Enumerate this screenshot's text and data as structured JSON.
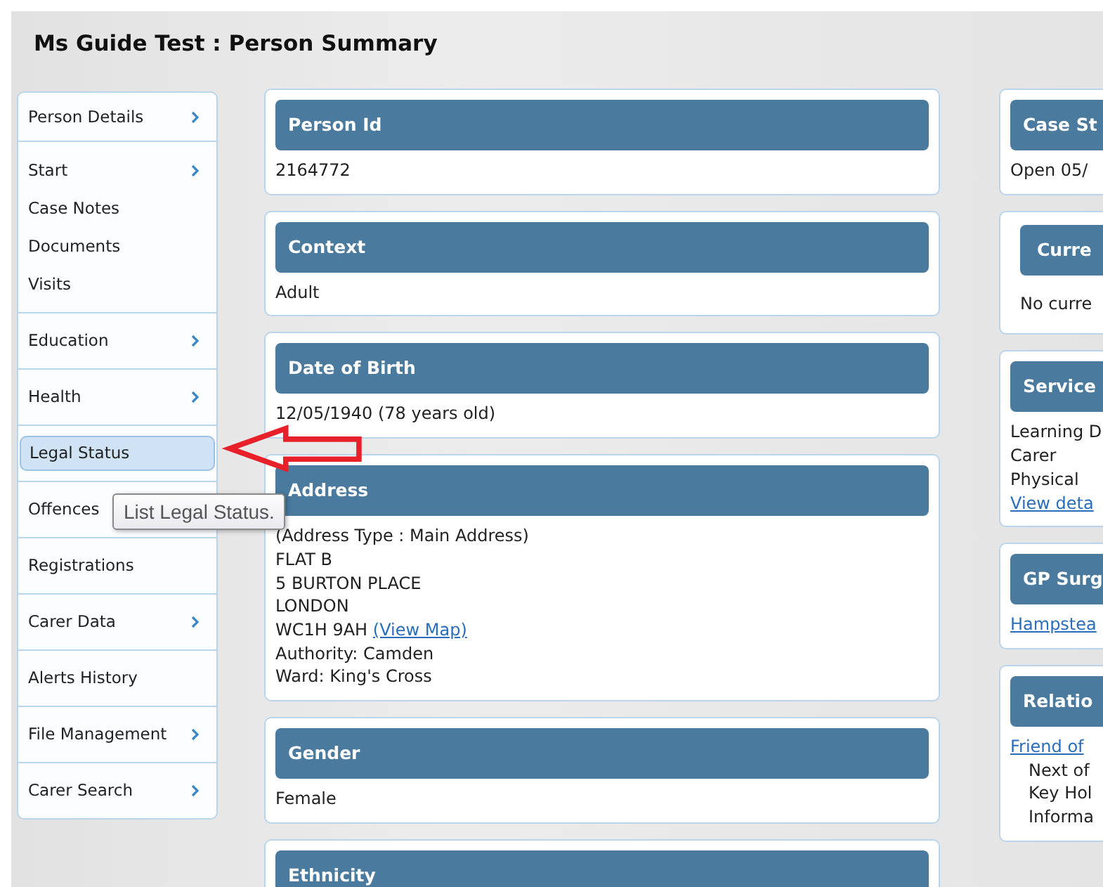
{
  "page": {
    "title": "Ms Guide Test : Person Summary"
  },
  "sidebar": {
    "groups": [
      {
        "items": [
          {
            "label": "Person Details",
            "has_submenu": true,
            "selected": false
          }
        ]
      },
      {
        "items": [
          {
            "label": "Start",
            "has_submenu": true,
            "selected": false
          },
          {
            "label": "Case Notes",
            "has_submenu": false,
            "selected": false
          },
          {
            "label": "Documents",
            "has_submenu": false,
            "selected": false
          },
          {
            "label": "Visits",
            "has_submenu": false,
            "selected": false
          }
        ]
      },
      {
        "items": [
          {
            "label": "Education",
            "has_submenu": true,
            "selected": false
          }
        ]
      },
      {
        "items": [
          {
            "label": "Health",
            "has_submenu": true,
            "selected": false
          }
        ]
      },
      {
        "items": [
          {
            "label": "Legal Status",
            "has_submenu": false,
            "selected": true
          }
        ]
      },
      {
        "items": [
          {
            "label": "Offences",
            "selected": false
          }
        ]
      },
      {
        "items": [
          {
            "label": "Registrations",
            "has_submenu": false,
            "selected": false
          }
        ]
      },
      {
        "items": [
          {
            "label": "Carer Data",
            "has_submenu": true,
            "selected": false
          }
        ]
      },
      {
        "items": [
          {
            "label": "Alerts History",
            "has_submenu": false,
            "selected": false
          }
        ]
      },
      {
        "items": [
          {
            "label": "File Management",
            "has_submenu": true,
            "selected": false
          }
        ]
      },
      {
        "items": [
          {
            "label": "Carer Search",
            "has_submenu": true,
            "selected": false
          }
        ]
      }
    ]
  },
  "tooltip": {
    "text": "List Legal Status."
  },
  "main_cards": [
    {
      "title": "Person Id",
      "lines": [
        {
          "kind": "text",
          "text": "2164772"
        }
      ]
    },
    {
      "title": "Context",
      "lines": [
        {
          "kind": "text",
          "text": "Adult"
        }
      ]
    },
    {
      "title": "Date of Birth",
      "lines": [
        {
          "kind": "text",
          "text": "12/05/1940 (78 years old)"
        }
      ]
    },
    {
      "title": "Address",
      "lines": [
        {
          "kind": "text",
          "text": "(Address Type : Main Address)"
        },
        {
          "kind": "text",
          "text": "FLAT B"
        },
        {
          "kind": "text",
          "text": "5 BURTON PLACE"
        },
        {
          "kind": "text",
          "text": "LONDON"
        },
        {
          "kind": "text",
          "text": "WC1H 9AH",
          "link": "(View Map)"
        },
        {
          "kind": "text",
          "text": "Authority: Camden"
        },
        {
          "kind": "text",
          "text": "Ward: King's Cross"
        }
      ]
    },
    {
      "title": "Gender",
      "lines": [
        {
          "kind": "text",
          "text": "Female"
        }
      ]
    },
    {
      "title": "Ethnicity"
    }
  ],
  "side_cards": [
    {
      "title": "Case St",
      "inset": false,
      "lines": [
        {
          "kind": "text",
          "text": "Open 05/"
        }
      ]
    },
    {
      "title": "Curre",
      "inset": true,
      "lines": [
        {
          "kind": "text",
          "text": "No curre"
        }
      ]
    },
    {
      "title": "Service",
      "inset": false,
      "lines": [
        {
          "kind": "text",
          "text": "Learning D"
        },
        {
          "kind": "text",
          "text": "Carer"
        },
        {
          "kind": "text",
          "text": "Physical"
        },
        {
          "kind": "link",
          "text": "View deta"
        }
      ]
    },
    {
      "title": "GP Surg",
      "inset": false,
      "lines": [
        {
          "kind": "link",
          "text": "Hampstea"
        }
      ]
    },
    {
      "title": "Relatio",
      "inset": false,
      "lines": [
        {
          "kind": "link",
          "text": "Friend of"
        },
        {
          "kind": "sub",
          "text": "Next of"
        },
        {
          "kind": "sub",
          "text": "Key Hol"
        },
        {
          "kind": "sub",
          "text": "Informa"
        }
      ]
    }
  ]
}
